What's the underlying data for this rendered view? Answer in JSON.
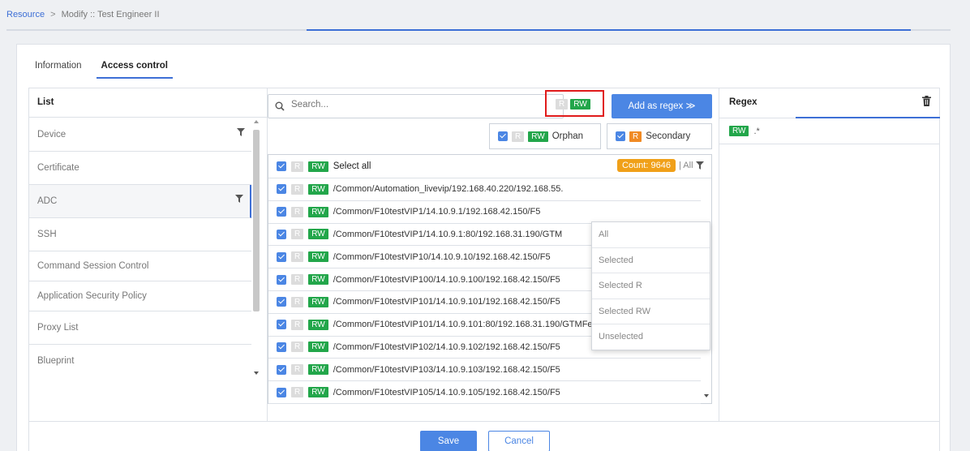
{
  "breadcrumb": {
    "root": "Resource",
    "separator": ">",
    "current": "Modify :: Test Engineer II"
  },
  "tabs": [
    {
      "label": "Information"
    },
    {
      "label": "Access control"
    }
  ],
  "list": {
    "header": "List",
    "items": [
      {
        "label": "Device"
      },
      {
        "label": "Certificate"
      },
      {
        "label": "ADC"
      },
      {
        "label": "SSH"
      },
      {
        "label": "Command Session Control"
      },
      {
        "label": "Application Security Policy"
      },
      {
        "label": "Proxy List"
      },
      {
        "label": "Blueprint"
      }
    ]
  },
  "search": {
    "placeholder": "Search...",
    "value": ""
  },
  "perm": {
    "r": "R",
    "rw": "RW"
  },
  "add_regex_label": "Add as regex ≫",
  "orphan_label": "Orphan",
  "secondary_label": "Secondary",
  "select_all_label": "Select all",
  "count_label": "Count: 9646",
  "all_filter_label": "| All",
  "resources": [
    "/Common/Automation_livevip/192.168.40.220/192.168.55.",
    "/Common/F10testVIP1/14.10.9.1/192.168.42.150/F5",
    "/Common/F10testVIP1/14.10.9.1:80/192.168.31.190/GTM",
    "/Common/F10testVIP10/14.10.9.10/192.168.42.150/F5",
    "/Common/F10testVIP100/14.10.9.100/192.168.42.150/F5",
    "/Common/F10testVIP101/14.10.9.101/192.168.42.150/F5",
    "/Common/F10testVIP101/14.10.9.101:80/192.168.31.190/GTMFetchConfig...",
    "/Common/F10testVIP102/14.10.9.102/192.168.42.150/F5",
    "/Common/F10testVIP103/14.10.9.103/192.168.42.150/F5",
    "/Common/F10testVIP105/14.10.9.105/192.168.42.150/F5"
  ],
  "dropdown": [
    "All",
    "Selected",
    "Selected R",
    "Selected RW",
    "Unselected"
  ],
  "regex": {
    "header": "Regex",
    "entries": [
      {
        "badge": "RW",
        "pattern": ".*"
      }
    ]
  },
  "footer": {
    "save": "Save",
    "cancel": "Cancel"
  },
  "colors": {
    "accent": "#4b86e4",
    "rw_green": "#22a64a",
    "r_orange": "#f08a24",
    "count_orange": "#f0a019",
    "highlight_red": "#e01b1b"
  }
}
